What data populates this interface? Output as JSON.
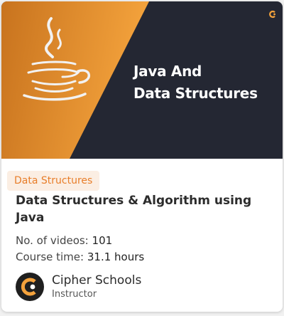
{
  "thumbnail": {
    "banner_line1": "Java And",
    "banner_line2": "Data Structures",
    "logo_icon": "java-cup-logo",
    "corner_icon": "cipher-schools-logo",
    "colors": {
      "orange_start": "#c8731e",
      "orange_end": "#f4a23c",
      "dark": "#242733",
      "cup": "#f2f2f2"
    }
  },
  "course": {
    "category": "Data Structures",
    "title": "Data Structures & Algorithm using Java",
    "videos_label": "No. of videos:",
    "videos_value": "101",
    "time_label": "Course time:",
    "time_value": "31.1 hours"
  },
  "instructor": {
    "name": "Cipher Schools",
    "role": "Instructor",
    "avatar_icon": "cipher-schools-avatar"
  },
  "colors": {
    "accent": "#e87e2a",
    "tag_bg": "#fbeee3"
  }
}
